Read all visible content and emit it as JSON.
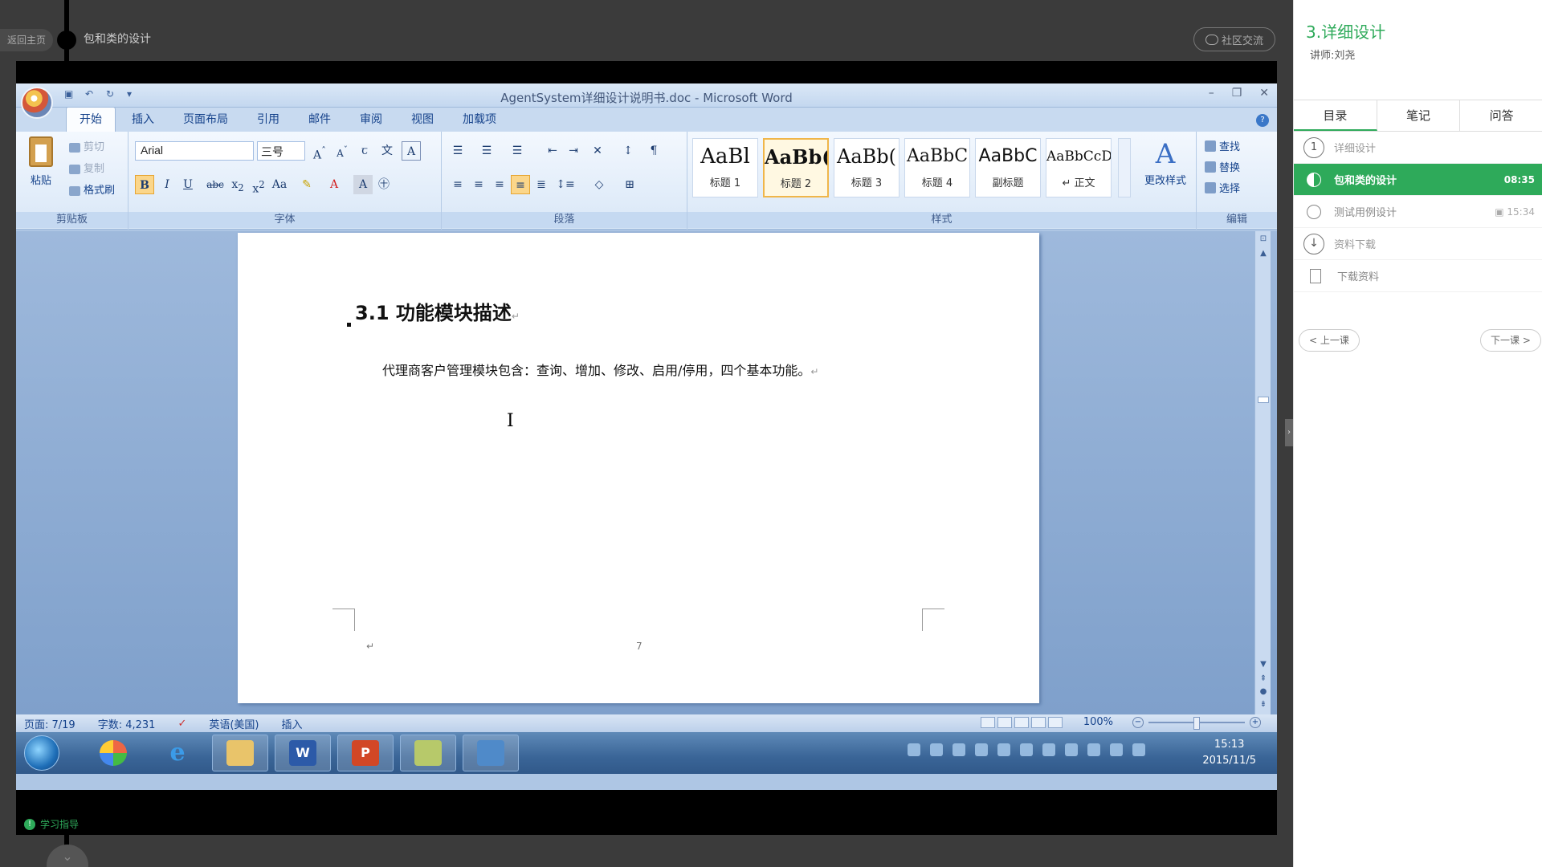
{
  "player": {
    "back_home": "返回主页",
    "lesson_crumb": "包和类的设计",
    "community": "社区交流",
    "study_guide": "学习指导"
  },
  "word": {
    "title": "AgentSystem详细设计说明书.doc - Microsoft Word",
    "tabs": [
      "开始",
      "插入",
      "页面布局",
      "引用",
      "邮件",
      "审阅",
      "视图",
      "加载项"
    ],
    "clipboard": {
      "paste": "粘贴",
      "cut": "剪切",
      "copy": "复制",
      "format_painter": "格式刷",
      "group": "剪贴板"
    },
    "font": {
      "name": "Arial",
      "size": "三号",
      "group": "字体"
    },
    "paragraph": {
      "group": "段落"
    },
    "styles": {
      "group": "样式",
      "items": [
        {
          "sample": "AaBl",
          "name": "标题 1"
        },
        {
          "sample": "AaBb(",
          "name": "标题 2"
        },
        {
          "sample": "AaBb(",
          "name": "标题 3"
        },
        {
          "sample": "AaBbC",
          "name": "标题 4"
        },
        {
          "sample": "AaBbC",
          "name": "副标题"
        },
        {
          "sample": "AaBbCcDc",
          "name": "↵ 正文"
        }
      ],
      "change": "更改样式"
    },
    "editing": {
      "find": "查找",
      "replace": "替换",
      "select": "选择",
      "group": "编辑"
    },
    "document": {
      "heading": "3.1  功能模块描述",
      "paragraph": "代理商客户管理模块包含：查询、增加、修改、启用/停用，四个基本功能。",
      "page_number": "7",
      "pilcrow": "↵"
    },
    "status": {
      "page": "页面: 7/19",
      "words": "字数: 4,231",
      "language": "英语(美国)",
      "mode": "插入",
      "zoom": "100%"
    }
  },
  "taskbar": {
    "time": "15:13",
    "date": "2015/11/5",
    "apps": [
      "start",
      "apps-grid",
      "ie",
      "explorer",
      "word",
      "powerpoint",
      "notes",
      "gallery"
    ]
  },
  "sidebar": {
    "course_title": "3.详细设计",
    "teacher": "讲师:刘尧",
    "tabs": [
      "目录",
      "笔记",
      "问答"
    ],
    "items": [
      {
        "num": "1",
        "label": "详细设计"
      },
      {
        "label": "包和类的设计",
        "time": "08:35"
      },
      {
        "label": "测试用例设计",
        "time": "15:34"
      },
      {
        "label": "资料下载"
      },
      {
        "label": "下载资料"
      }
    ],
    "prev": "< 上一课",
    "next": "下一课 >"
  },
  "colors": {
    "accent": "#2eaa5a",
    "word_blue": "#15428b"
  }
}
